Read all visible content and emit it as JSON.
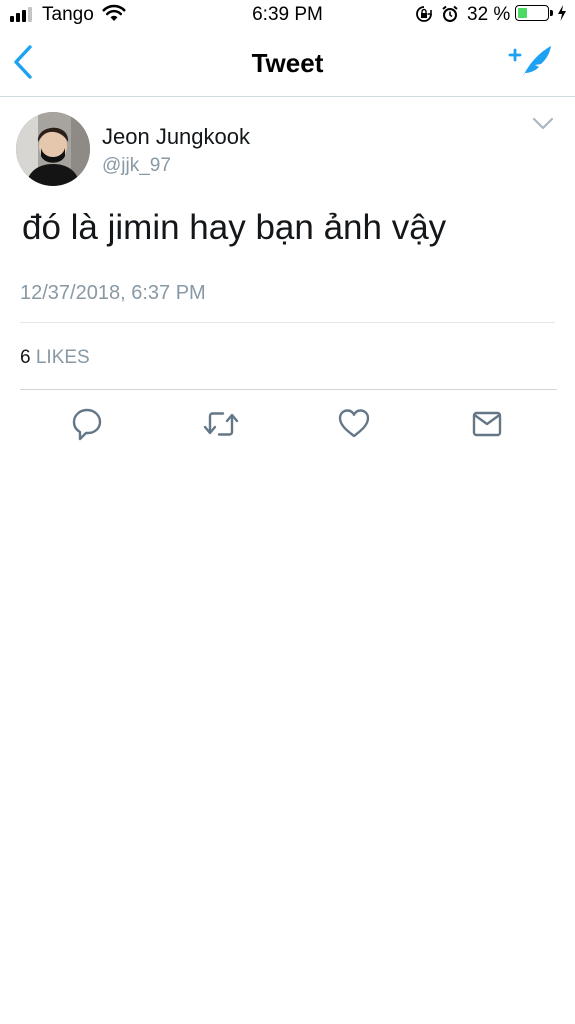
{
  "status_bar": {
    "carrier": "Tango",
    "time": "6:39 PM",
    "battery_text": "32 %",
    "battery_level": 0.32,
    "battery_color": "#4cd964",
    "icons": [
      "signal-icon",
      "wifi-icon",
      "orientation-lock-icon",
      "alarm-icon",
      "battery-icon",
      "charging-bolt-icon"
    ]
  },
  "nav": {
    "title": "Tweet",
    "back_icon": "chevron-left-icon",
    "compose_icon": "compose-tweet-icon"
  },
  "tweet": {
    "author_name": "Jeon Jungkook",
    "author_handle": "@jjk_97",
    "text": "đó là jimin hay bạn ảnh vậy",
    "timestamp": "12/37/2018, 6:37 PM",
    "likes_count": "6",
    "likes_label": "LIKES",
    "actions": [
      "reply-icon",
      "retweet-icon",
      "like-icon",
      "direct-message-icon"
    ]
  },
  "colors": {
    "accent": "#1da1f2",
    "secondary_text": "#8899a6",
    "action_icons": "#657786"
  }
}
